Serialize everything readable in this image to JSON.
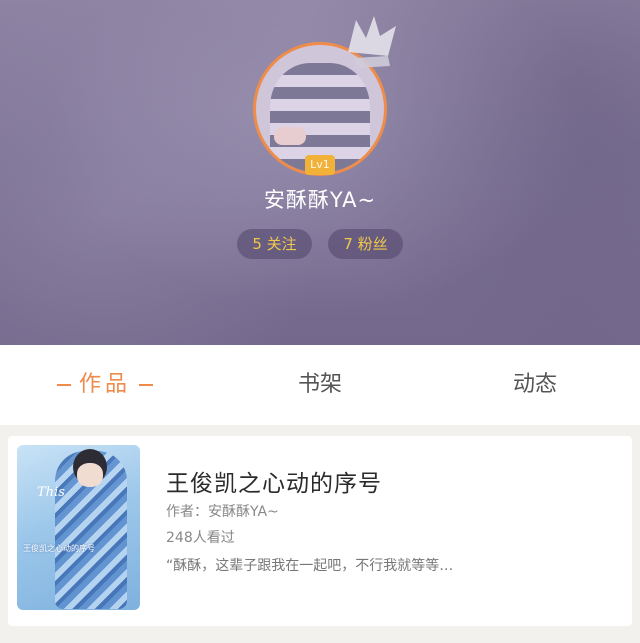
{
  "profile": {
    "level": "Lv1",
    "username": "安酥酥YA~",
    "following": "5 关注",
    "fans": "7 粉丝",
    "accent_color": "#f08c4a",
    "stat_color": "#f1c84b",
    "crown_icon": "crown-icon"
  },
  "tabs": [
    {
      "label": "作品",
      "active": true
    },
    {
      "label": "书架",
      "active": false
    },
    {
      "label": "动态",
      "active": false
    }
  ],
  "works": [
    {
      "title": "王俊凯之心动的序号",
      "author": "作者：安酥酥YA~",
      "views": "248人看过",
      "excerpt": "“酥酥，这辈子跟我在一起吧，不行我就等等…",
      "cover_text": "王俊凯之心动的序号",
      "cover_word": "This"
    }
  ]
}
